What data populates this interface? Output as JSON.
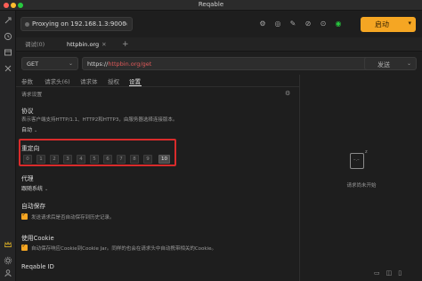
{
  "app": {
    "title": "Reqable"
  },
  "proxy": {
    "text": "Proxying on 192.168.1.3:9000"
  },
  "toolbar": {
    "icons": [
      "settings-icon",
      "hide-icon",
      "tool-icon",
      "ban-icon",
      "lock-icon",
      "shield-icon"
    ],
    "icon_glyphs": [
      "⚙",
      "◎",
      "✎",
      "⊘",
      "⊙",
      "◉"
    ],
    "start_label": "启动",
    "start_arrow": "▾",
    "brand_color": "#f5a623"
  },
  "tabs": [
    {
      "label": "调试(0)",
      "close": "✕"
    },
    {
      "label": "httpbin.org",
      "close": "✕"
    }
  ],
  "tab_add": "+",
  "request": {
    "method": "GET",
    "url_prefix": "https://",
    "url_host": "httpbin.org",
    "url_path": "/get",
    "send_label": "发送",
    "chevron": "⌄"
  },
  "request_tabs": [
    "参数",
    "请求头(6)",
    "请求体",
    "授权",
    "设置"
  ],
  "settings": {
    "section_title": "请求设置",
    "protocol": {
      "title": "协议",
      "desc": "表示客户端支持HTTP/1.1、HTTP2和HTTP3，由服务器选择连接版本。",
      "value": "自动"
    },
    "redirect": {
      "title": "重定向",
      "values": [
        "0",
        "1",
        "2",
        "3",
        "4",
        "5",
        "6",
        "7",
        "8",
        "9",
        "10"
      ],
      "selected": "10"
    },
    "proxy": {
      "title": "代理",
      "value": "跟随系统"
    },
    "autosave": {
      "title": "自动保存",
      "label": "发送请求后是否自动保存到历史记录。"
    },
    "cookie": {
      "title": "使用Cookie",
      "label": "自动保存响应Cookie到Cookie Jar。同样的也会在请求头中自动携带相关的Cookie。"
    },
    "reqable_id": {
      "title": "Reqable ID"
    }
  },
  "response": {
    "empty_text": "请求尚未开始"
  }
}
